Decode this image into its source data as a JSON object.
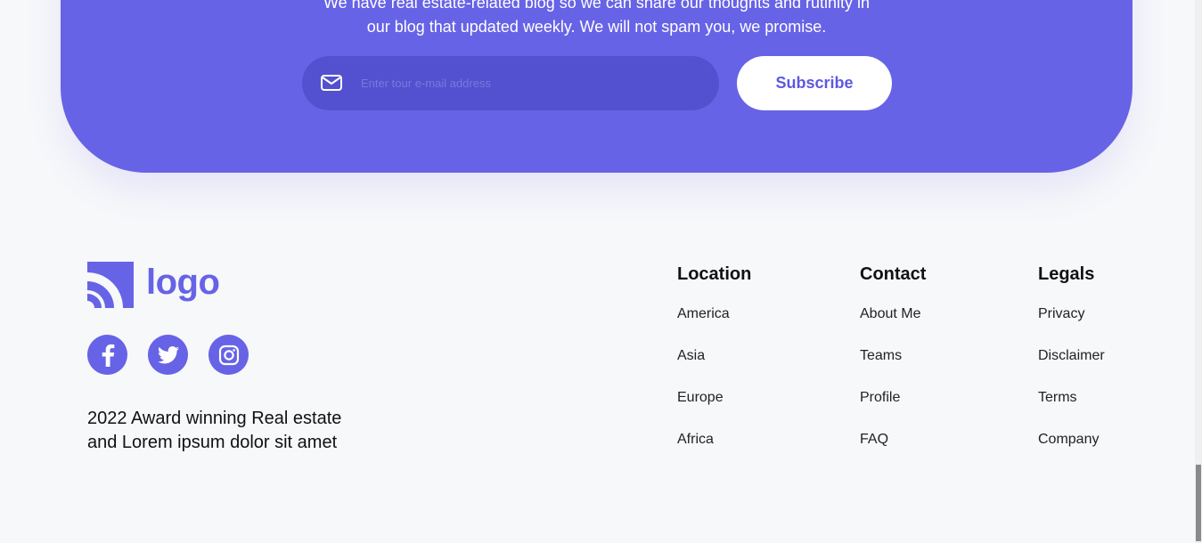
{
  "newsletter": {
    "line1": "We have real estate-related blog so we can share our thoughts and rutinity in",
    "line2": "our blog that updated weekly. We will not spam you, we promise.",
    "email_placeholder": "Enter tour e-mail address",
    "subscribe_label": "Subscribe",
    "mail_icon": "mail-icon"
  },
  "brand": {
    "logo_text": "logo",
    "accent_color": "#6763e6"
  },
  "socials": [
    {
      "name": "facebook",
      "icon": "facebook-icon"
    },
    {
      "name": "twitter",
      "icon": "twitter-icon"
    },
    {
      "name": "instagram",
      "icon": "instagram-icon"
    }
  ],
  "tagline": {
    "line1": "2022 Award winning Real estate",
    "line2": "and Lorem ipsum dolor sit amet"
  },
  "columns": {
    "location": {
      "title": "Location",
      "items": [
        "America",
        "Asia",
        "Europe",
        "Africa"
      ]
    },
    "contact": {
      "title": "Contact",
      "items": [
        "About Me",
        "Teams",
        "Profile",
        "FAQ"
      ]
    },
    "legals": {
      "title": "Legals",
      "items": [
        "Privacy",
        "Disclaimer",
        "Terms",
        "Company"
      ]
    }
  }
}
